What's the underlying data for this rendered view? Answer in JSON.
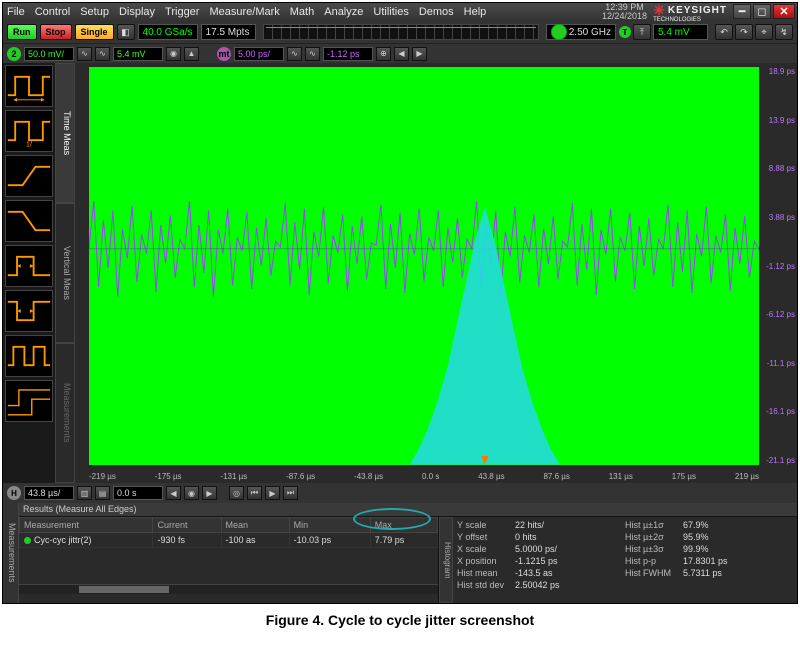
{
  "menu": [
    "File",
    "Control",
    "Setup",
    "Display",
    "Trigger",
    "Measure/Mark",
    "Math",
    "Analyze",
    "Utilities",
    "Demos",
    "Help"
  ],
  "clock": {
    "time": "12:39 PM",
    "date": "12/24/2018"
  },
  "brand": {
    "name": "KEYSIGHT",
    "sub": "TECHNOLOGIES"
  },
  "toolbar": {
    "run": "Run",
    "stop": "Stop",
    "single": "Single",
    "sample_rate": "40.0 GSa/s",
    "mem_depth": "17.5 Mpts",
    "bandwidth": "2.50 GHz",
    "trigger_level": "5.4 mV"
  },
  "channel": {
    "ch2": {
      "scale": "50.0 mV/",
      "offset": "5.4 mV"
    },
    "mt": {
      "scale": "5.00 ps/",
      "offset": "-1.12 ps"
    }
  },
  "horizontal": {
    "scale": "43.8 µs/",
    "position": "0.0 s"
  },
  "yaxis": [
    "18.9 ps",
    "13.9 ps",
    "8.88 ps",
    "3.88 ps",
    "-1.12 ps",
    "-6.12 ps",
    "-11.1 ps",
    "-16.1 ps",
    "-21.1 ps"
  ],
  "xaxis": [
    "-219 µs",
    "-175 µs",
    "-131 µs",
    "-87.6 µs",
    "-43.8 µs",
    "0.0 s",
    "43.8 µs",
    "87.6 µs",
    "131 µs",
    "175 µs",
    "219 µs"
  ],
  "tabs": {
    "time": "Time Meas",
    "vert": "Vertical Meas",
    "meas": "Measurements",
    "hist": "Histogram"
  },
  "results": {
    "title": "Results (Measure All Edges)",
    "headers": [
      "Measurement",
      "Current",
      "Mean",
      "Min",
      "Max"
    ],
    "rows": [
      {
        "name": "Cyc-cyc jittr(2)",
        "current": "-930 fs",
        "mean": "-100 as",
        "min": "-10.03 ps",
        "max": "7.79 ps"
      }
    ],
    "hist": [
      {
        "k": "Y scale",
        "v": "22 hits/"
      },
      {
        "k": "Y offset",
        "v": "0 hits"
      },
      {
        "k": "X scale",
        "v": "5.0000 ps/"
      },
      {
        "k": "X position",
        "v": "-1.1215 ps"
      },
      {
        "k": "Hist mean",
        "v": "-143.5 as"
      },
      {
        "k": "Hist std dev",
        "v": "2.50042 ps"
      },
      {
        "k": "Hist µ±1σ",
        "v": "67.9%"
      },
      {
        "k": "Hist µ±2σ",
        "v": "95.9%"
      },
      {
        "k": "Hist µ±3σ",
        "v": "99.9%"
      },
      {
        "k": "Hist p-p",
        "v": "17.8301 ps"
      },
      {
        "k": "Hist FWHM",
        "v": "5.7311 ps"
      }
    ]
  },
  "caption": "Figure 4. Cycle to cycle jitter screenshot"
}
